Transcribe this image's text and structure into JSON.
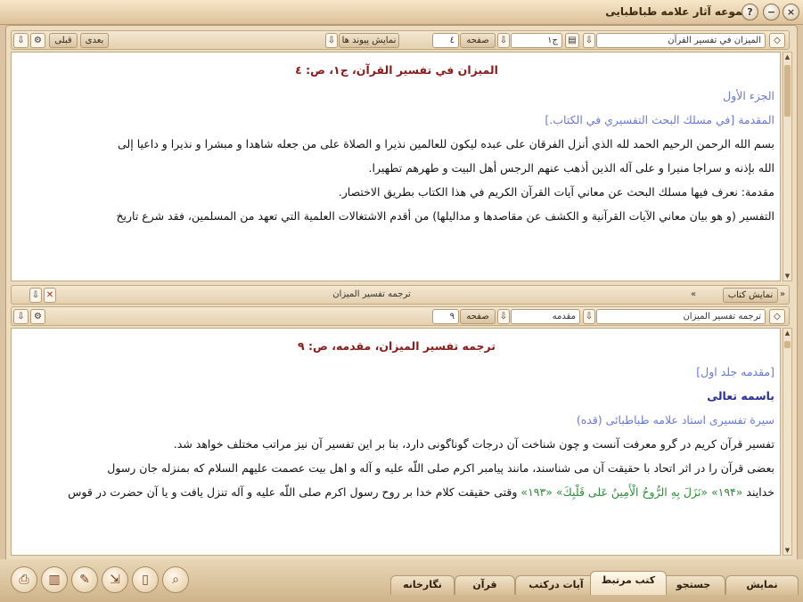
{
  "window": {
    "title": "مجموعه آثار علامه طباطبایی"
  },
  "top_toolbar": {
    "book_select": "الميزان في تفسير القرآن",
    "volume_select": "ج۱",
    "page_label": "صفحه",
    "page_value": "٤",
    "show_links": "نمایش پیوند ها",
    "next": "بعدی",
    "prev": "قبلی"
  },
  "top_pane": {
    "header": "الميزان في تفسير القرآن، ج۱، ص: ٤",
    "lines": [
      "الجزء الأول",
      "المقدمة [في مسلك البحث التفسيري في الكتاب.]",
      "بسم الله الرحمن الرحيم الحمد لله الذي أنزل الفرقان على عبده ليكون للعالمين نذيرا و الصلاة على من جعله شاهدا و مبشرا و نذيرا و داعيا إلى",
      "الله بإذنه و سراجا منيرا و على آله الذين أذهب عنهم الرجس أهل البيت و طهرهم تطهيرا.",
      "مقدمة: نعرف فيها مسلك البحث عن معاني آيات القرآن الكريم في هذا الكتاب بطريق الاختصار.",
      "التفسير (و هو بيان معاني الآيات القرآنية و الكشف عن مقاصدها و مداليلها) من أقدم الاشتغالات العلمية التي تعهد من المسلمين، فقد شرع تاريخ"
    ]
  },
  "mid_bar": {
    "show_book": "نمایش کتاب",
    "translation_label": "ترجمه تفسیر المیزان"
  },
  "bottom_toolbar": {
    "book_select": "ترجمه تفسير الميزان",
    "volume_select": "مقدمه",
    "page_label": "صفحه",
    "page_value": "۹"
  },
  "bottom_pane": {
    "header": "ترجمه تفسير الميزان، مقدمه، ص: ۹",
    "lines": [
      "[مقدمه جلد اول]",
      "باسمه تعالى",
      "سيرة تفسيرى استاد علامه طباطبائى (قده)",
      "تفسير قرآن كريم در گرو معرفت آنست و چون شناخت آن درجات گوناگونى دارد، بنا بر اين تفسير آن نيز مراتب مختلف خواهد شد.",
      "بعضى قرآن را در اثر اتحاد با حقيقت آن مى شناسند، مانند پيامبر اكرم صلى اللّه عليه و آله و اهل بيت عصمت عليهم السلام كه بمنزله جان رسول",
      "وقتى حقيقت كلام خدا بر روح رسول اكرم صلى اللّه عليه و آله تنزل يافت و يا آن حضرت در قوس"
    ],
    "verse": "«نَزَلَ بِهِ الرُّوحُ الْأَمِينُ عَلى‏ قَلْبِكَ»",
    "verse_ref_left": "«۱۹۳»",
    "verse_ref_right": "«۱۹۴»",
    "line_lead": "خدايند"
  },
  "tabs": [
    {
      "label": "نمایش"
    },
    {
      "label": "جستجو"
    },
    {
      "label": "کتب مرتبط"
    },
    {
      "label": "آیات درکتب"
    },
    {
      "label": "قرآن"
    },
    {
      "label": "نگارخانه"
    }
  ],
  "icons": {
    "close": "close-icon",
    "minimize": "minimize-icon",
    "help": "help-icon"
  },
  "colors": {
    "header": "#8b1a1a",
    "heading_blue": "#6a78d6",
    "verse_green": "#2f8a3a",
    "chrome": "#d9c3a3"
  }
}
